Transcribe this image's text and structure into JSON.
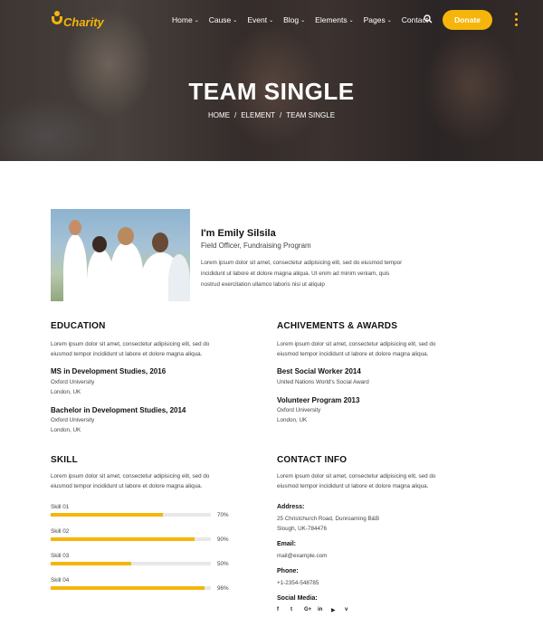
{
  "brand": {
    "name": "Charity",
    "accent": "#f5b50a"
  },
  "nav": [
    {
      "label": "Home",
      "dropdown": true
    },
    {
      "label": "Cause",
      "dropdown": true
    },
    {
      "label": "Event",
      "dropdown": true
    },
    {
      "label": "Blog",
      "dropdown": true
    },
    {
      "label": "Elements",
      "dropdown": true
    },
    {
      "label": "Pages",
      "dropdown": true
    },
    {
      "label": "Contact",
      "dropdown": false
    }
  ],
  "header": {
    "donate_label": "Donate",
    "search_icon": "search-icon",
    "menu_icon": "kebab-menu-icon"
  },
  "hero": {
    "title": "TEAM SINGLE",
    "breadcrumbs": [
      "HOME",
      "ELEMENT",
      "TEAM SINGLE"
    ],
    "separator": "/"
  },
  "profile": {
    "name": "I'm Emily Silsila",
    "role": "Field Officer, Fundraising Program",
    "bio_lines": [
      "Lorem ipsum dolor sit amet, consectetur adipisicing elit, sed do eiusmod tempor",
      "incididunt ut labore et dolore magna aliqua. Ut enim ad minim veniam, quis",
      "nostrud exercitation ullamco laboris nisi ut aliquip"
    ]
  },
  "education": {
    "title": "EDUCATION",
    "intro_lines": [
      "Lorem ipsum dolor sit amet, consectetur adipisicing elit, sed do",
      "eiusmod tempor incididunt ut labore et dolore magna aliqua."
    ],
    "items": [
      {
        "title": "MS in Development Studies, 2016",
        "line1": "Oxford University",
        "line2": "London, UK"
      },
      {
        "title": "Bachelor in Development Studies, 2014",
        "line1": "Oxford University",
        "line2": "London, UK"
      }
    ]
  },
  "awards": {
    "title": "ACHIVEMENTS & AWARDS",
    "intro_lines": [
      "Lorem ipsum dolor sit amet, consectetur adipisicing elit, sed do",
      "eiusmod tempor incididunt ut labore et dolore magna aliqua."
    ],
    "items": [
      {
        "title": "Best Social Worker 2014",
        "line1": "United Nations World's Social Award",
        "line2": ""
      },
      {
        "title": "Volunteer Program 2013",
        "line1": "Oxford University",
        "line2": "London, UK"
      }
    ]
  },
  "skill": {
    "title": "SKILL",
    "intro_lines": [
      "Lorem ipsum dolor sit amet, consectetur adipisicing elit, sed do",
      "eiusmod tempor incididunt ut labore et dolore magna aliqua."
    ],
    "items": [
      {
        "label": "Skill 01",
        "percent": 70,
        "percent_label": "70%"
      },
      {
        "label": "Skill 02",
        "percent": 90,
        "percent_label": "90%"
      },
      {
        "label": "Skill 03",
        "percent": 50,
        "percent_label": "50%"
      },
      {
        "label": "Skill 04",
        "percent": 96,
        "percent_label": "96%"
      }
    ]
  },
  "contact": {
    "title": "CONTACT INFO",
    "intro_lines": [
      "Lorem ipsum dolor sit amet, consectetur adipisicing elit, sed do",
      "eiusmod tempor incididunt ut labore et dolore magna aliqua."
    ],
    "address_label": "Address:",
    "address_lines": [
      "25 Christchurch Road, Dunroaming B&B",
      "Slough, UK-784476"
    ],
    "email_label": "Email:",
    "email": "mail@example.com",
    "phone_label": "Phone:",
    "phone": "+1-2354-548785",
    "social_label": "Social Media:",
    "socials": [
      {
        "icon": "facebook-icon",
        "glyph": "f"
      },
      {
        "icon": "twitter-icon",
        "glyph": "t"
      },
      {
        "icon": "google-plus-icon",
        "glyph": "G+"
      },
      {
        "icon": "linkedin-icon",
        "glyph": "in"
      },
      {
        "icon": "youtube-icon",
        "glyph": "▶"
      },
      {
        "icon": "vimeo-icon",
        "glyph": "v"
      }
    ]
  }
}
